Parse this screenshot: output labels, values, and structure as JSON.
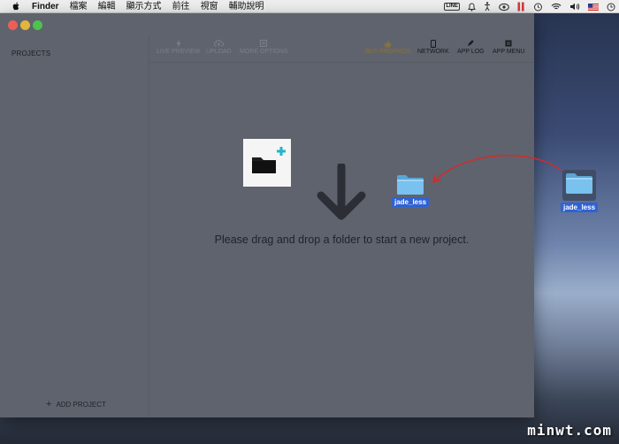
{
  "menubar": {
    "app_name": "Finder",
    "items": [
      "檔案",
      "編輯",
      "顯示方式",
      "前往",
      "視窗",
      "輔助說明"
    ],
    "status_badge": "LINE"
  },
  "sidebar": {
    "header": "PROJECTS",
    "add_project_label": "ADD PROJECT"
  },
  "toolbar": {
    "live_preview": "LIVE PREVIEW",
    "upload": "UPLOAD",
    "more_options": "MORE OPTIONS",
    "buy_propros": "BUY PROPROS",
    "network": "NETWORK",
    "app_log": "APP LOG",
    "app_menu": "APP MENU"
  },
  "main": {
    "drop_message": "Please drag and drop a folder to start a new project."
  },
  "drag": {
    "folder_name": "jade_less",
    "desktop_folder_name": "jade_less",
    "arrow_color": "#d6292a",
    "selection_color": "#2f62d6"
  },
  "icons": [
    "apple-icon",
    "notification-bell-icon",
    "wifi-icon",
    "volume-icon",
    "flag-icon",
    "folder-add-icon",
    "down-arrow-icon",
    "folder-icon",
    "thumbs-up-icon",
    "phone-icon",
    "pen-icon",
    "menu-icon"
  ],
  "watermark": "minwt.com"
}
